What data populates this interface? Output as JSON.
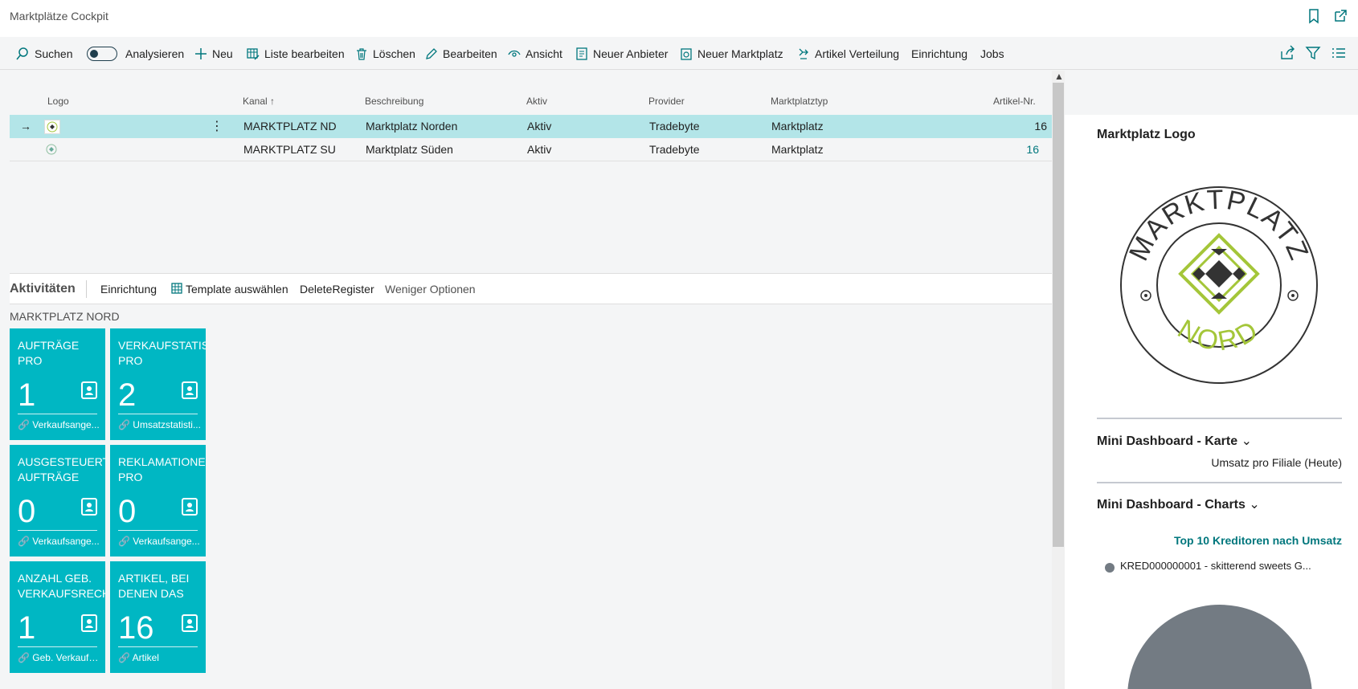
{
  "page": {
    "title": "Marktplätze Cockpit"
  },
  "actions": {
    "search": "Suchen",
    "analyze": "Analysieren",
    "new": "Neu",
    "edit_list": "Liste bearbeiten",
    "delete": "Löschen",
    "edit": "Bearbeiten",
    "view": "Ansicht",
    "new_provider": "Neuer Anbieter",
    "new_marketplace": "Neuer Marktplatz",
    "item_distribution": "Artikel Verteilung",
    "setup": "Einrichtung",
    "jobs": "Jobs"
  },
  "list": {
    "columns": {
      "logo": "Logo",
      "channel": "Kanal",
      "description": "Beschreibung",
      "active": "Aktiv",
      "provider": "Provider",
      "marketplace_type": "Marktplatztyp",
      "item_no": "Artikel-Nr."
    },
    "rows": [
      {
        "channel": "MARKTPLATZ ND",
        "description": "Marktplatz Norden",
        "active": "Aktiv",
        "provider": "Tradebyte",
        "marketplace_type": "Marktplatz",
        "item_no": "16"
      },
      {
        "channel": "MARKTPLATZ SU",
        "description": "Marktplatz Süden",
        "active": "Aktiv",
        "provider": "Tradebyte",
        "marketplace_type": "Marktplatz",
        "item_no": "16"
      }
    ]
  },
  "activities": {
    "title": "Aktivitäten",
    "setup": "Einrichtung",
    "select_template": "Template auswählen",
    "delete_register": "DeleteRegister",
    "fewer_options": "Weniger Optionen",
    "group": "MARKTPLATZ NORD",
    "tiles": [
      {
        "title": "AUFTRÄGE PRO\nMARKPLATZ",
        "value": "1",
        "link": "Verkaufsange..."
      },
      {
        "title": "VERKAUFSTATIS\nPRO",
        "value": "2",
        "link": "Umsatzstatisti..."
      },
      {
        "title": "AUSGESTEUERTE\nAUFTRÄGE",
        "value": "0",
        "link": "Verkaufsange..."
      },
      {
        "title": "REKLAMATIONE\nPRO",
        "value": "0",
        "link": "Verkaufsange..."
      },
      {
        "title": "ANZAHL GEB.\nVERKAUFSRECH",
        "value": "1",
        "link": "Geb. Verkaufsr..."
      },
      {
        "title": "ARTIKEL, BEI\nDENEN DAS",
        "value": "16",
        "link": "Artikel"
      }
    ]
  },
  "factbox": {
    "logo_title": "Marktplatz Logo",
    "logo_text_top": "MARKTPLATZ",
    "logo_text_bottom": "NORD",
    "map_title": "Mini Dashboard - Karte",
    "map_subtitle": "Umsatz pro Filiale (Heute)",
    "charts_title": "Mini Dashboard - Charts",
    "charts_link": "Top 10 Kreditoren nach Umsatz",
    "legend_item": "KRED000000001 - skitterend sweets G...",
    "legend_color": "#737b83"
  },
  "colors": {
    "accent": "#00777d",
    "tile": "#00b7c3",
    "selected_row": "#b3e5e8",
    "logo_green": "#a4c639"
  }
}
